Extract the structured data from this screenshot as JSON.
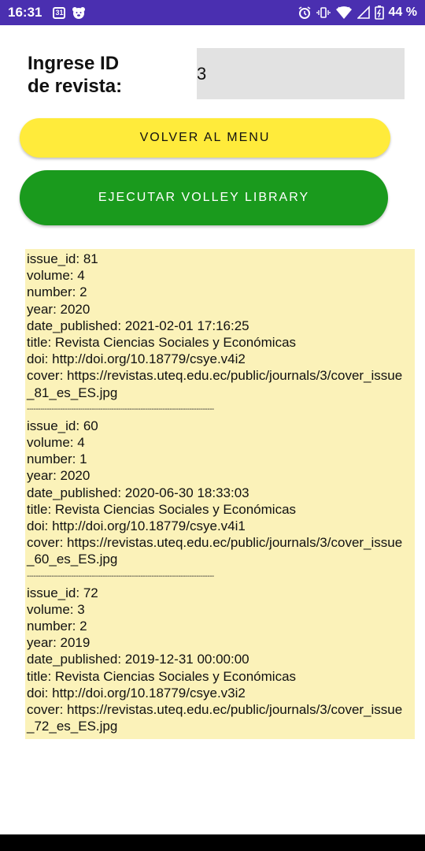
{
  "status_bar": {
    "time": "16:31",
    "calendar_day": "31",
    "battery_percent": "44 %"
  },
  "form": {
    "id_label": "Ingrese ID\nde revista:",
    "id_value": "3"
  },
  "buttons": {
    "menu_label": "VOLVER AL MENU",
    "volley_label": "EJECUTAR VOLLEY LIBRARY"
  },
  "results": {
    "separator": "------------------------------------------------------------------------------------",
    "issues": [
      {
        "issue_id": " issue_id: 81",
        "volume": "volume: 4",
        "number": "number: 2",
        "year": "year: 2020",
        "date_published": "date_published: 2021-02-01 17:16:25",
        "title": "title: Revista Ciencias Sociales y Económicas",
        "doi": "doi: http://doi.org/10.18779/csye.v4i2",
        "cover": "cover: https://revistas.uteq.edu.ec/public/journals/3/cover_issue_81_es_ES.jpg"
      },
      {
        "issue_id": "issue_id: 60",
        "volume": "volume: 4",
        "number": "number: 1",
        "year": "year: 2020",
        "date_published": "date_published: 2020-06-30 18:33:03",
        "title": "title: Revista Ciencias Sociales y Económicas",
        "doi": "doi: http://doi.org/10.18779/csye.v4i1",
        "cover": "cover: https://revistas.uteq.edu.ec/public/journals/3/cover_issue_60_es_ES.jpg"
      },
      {
        "issue_id": "issue_id: 72",
        "volume": "volume: 3",
        "number": "number: 2",
        "year": "year: 2019",
        "date_published": "date_published: 2019-12-31 00:00:00",
        "title": "title: Revista Ciencias Sociales y Económicas",
        "doi": "doi: http://doi.org/10.18779/csye.v3i2",
        "cover": "cover: https://revistas.uteq.edu.ec/public/journals/3/cover_issue_72_es_ES.jpg"
      }
    ]
  },
  "colors": {
    "status_bar": "#4a2fb0",
    "menu_button": "#ffeb3b",
    "volley_button": "#1a9a1d",
    "results_background": "#fbf2b9",
    "input_background": "#e2e2e2"
  }
}
